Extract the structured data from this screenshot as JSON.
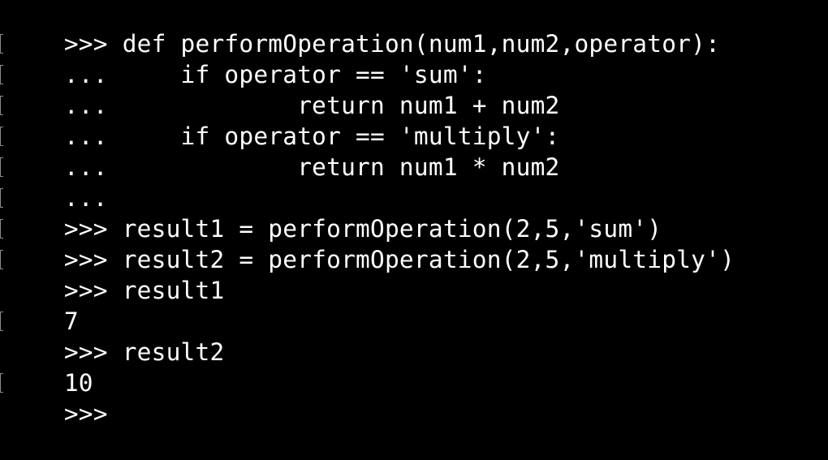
{
  "terminal": {
    "lines": [
      {
        "prompt": ">>> ",
        "code": "def performOperation(num1,num2,operator):"
      },
      {
        "prompt": "... ",
        "code": "    if operator == 'sum':"
      },
      {
        "prompt": "... ",
        "code": "            return num1 + num2"
      },
      {
        "prompt": "... ",
        "code": "    if operator == 'multiply':"
      },
      {
        "prompt": "... ",
        "code": "            return num1 * num2"
      },
      {
        "prompt": "... ",
        "code": ""
      },
      {
        "prompt": ">>> ",
        "code": "result1 = performOperation(2,5,'sum')"
      },
      {
        "prompt": ">>> ",
        "code": "result2 = performOperation(2,5,'multiply')"
      },
      {
        "prompt": ">>> ",
        "code": "result1"
      },
      {
        "prompt": "",
        "code": "7"
      },
      {
        "prompt": ">>> ",
        "code": "result2"
      },
      {
        "prompt": "",
        "code": "10"
      },
      {
        "prompt": ">>> ",
        "code": ""
      }
    ]
  }
}
